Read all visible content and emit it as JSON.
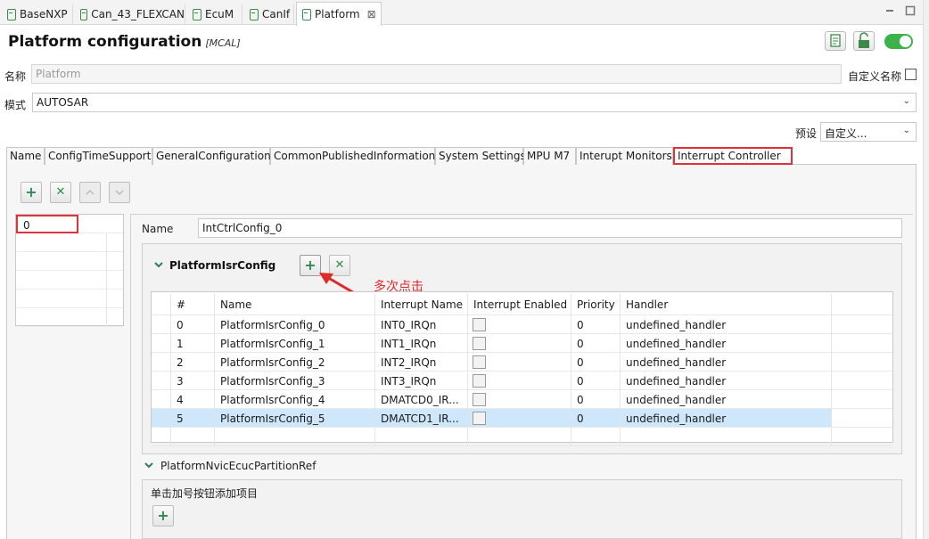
{
  "editor_tabs": [
    {
      "label": "BaseNXP"
    },
    {
      "label": "Can_43_FLEXCAN"
    },
    {
      "label": "EcuM"
    },
    {
      "label": "CanIf"
    },
    {
      "label": "Platform",
      "active": true,
      "close": "⊠"
    }
  ],
  "header": {
    "title": "Platform configuration",
    "subtitle": "[MCAL]"
  },
  "name_row": {
    "label": "名称",
    "value": "Platform",
    "custom_label": "自定义名称"
  },
  "mode_row": {
    "label": "模式",
    "value": "AUTOSAR"
  },
  "preset_row": {
    "label": "预设",
    "value": "自定义..."
  },
  "section_tabs": [
    {
      "label": "Name"
    },
    {
      "label": "ConfigTimeSupport"
    },
    {
      "label": "GeneralConfiguration"
    },
    {
      "label": "CommonPublishedInformation"
    },
    {
      "label": "System Settings"
    },
    {
      "label": "MPU M7"
    },
    {
      "label": "Interupt Monitors"
    },
    {
      "label": "Interrupt Controller",
      "active": true
    }
  ],
  "list_items": [
    "0"
  ],
  "detail": {
    "name_label": "Name",
    "name_value": "IntCtrlConfig_0"
  },
  "isr_group": {
    "title": "PlatformIsrConfig",
    "columns": [
      "#",
      "Name",
      "Interrupt Name",
      "Interrupt Enabled",
      "Priority",
      "Handler"
    ],
    "rows": [
      {
        "idx": "0",
        "name": "PlatformIsrConfig_0",
        "irq": "INT0_IRQn",
        "enabled": false,
        "priority": "0",
        "handler": "undefined_handler"
      },
      {
        "idx": "1",
        "name": "PlatformIsrConfig_1",
        "irq": "INT1_IRQn",
        "enabled": false,
        "priority": "0",
        "handler": "undefined_handler"
      },
      {
        "idx": "2",
        "name": "PlatformIsrConfig_2",
        "irq": "INT2_IRQn",
        "enabled": false,
        "priority": "0",
        "handler": "undefined_handler"
      },
      {
        "idx": "3",
        "name": "PlatformIsrConfig_3",
        "irq": "INT3_IRQn",
        "enabled": false,
        "priority": "0",
        "handler": "undefined_handler"
      },
      {
        "idx": "4",
        "name": "PlatformIsrConfig_4",
        "irq": "DMATCD0_IR...",
        "enabled": false,
        "priority": "0",
        "handler": "undefined_handler"
      },
      {
        "idx": "5",
        "name": "PlatformIsrConfig_5",
        "irq": "DMATCD1_IR...",
        "enabled": false,
        "priority": "0",
        "handler": "undefined_handler",
        "selected": true
      }
    ]
  },
  "annotation": "多次点击",
  "nvic_group": {
    "title": "PlatformNvicEcucPartitionRef",
    "hint": "单击加号按钮添加项目"
  },
  "icons": {
    "add": "+",
    "remove": "✕",
    "up": "⌃",
    "down": "⌄",
    "dropdown": "⌄"
  },
  "colors": {
    "accent_green": "#2f8a4d",
    "highlight_red": "#e0323a",
    "toggle_on": "#3bb34a",
    "selection": "#cfe7fb"
  }
}
